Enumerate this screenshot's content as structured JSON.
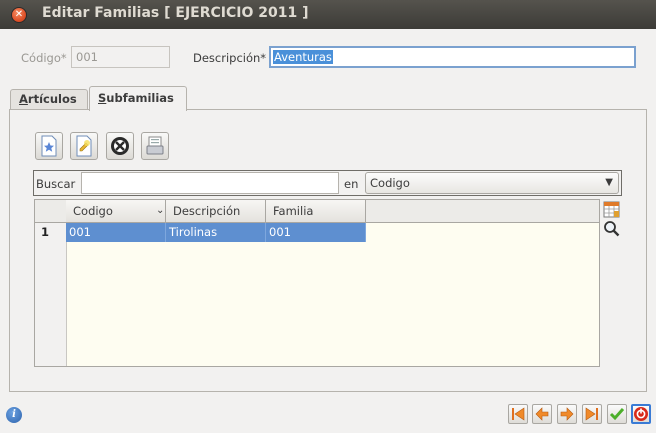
{
  "window": {
    "title": "Editar Familias [ EJERCICIO 2011 ]"
  },
  "form": {
    "codigo_label": "Código*",
    "codigo_value": "001",
    "descripcion_label": "Descripción*",
    "descripcion_value": "Aventuras"
  },
  "tabs": [
    {
      "label_mnemonic": "A",
      "label_rest": "rtículos",
      "active": false
    },
    {
      "label_mnemonic": "S",
      "label_rest": "ubfamilias",
      "active": true
    }
  ],
  "toolbar": {
    "icons": [
      "new-record-icon",
      "edit-record-icon",
      "delete-record-icon",
      "print-icon"
    ]
  },
  "search": {
    "label": "Buscar",
    "value": "",
    "in_label": "en",
    "field_selected": "Codigo"
  },
  "grid": {
    "columns": [
      "Codigo",
      "Descripción",
      "Familia"
    ],
    "sort_column": "Codigo",
    "rows": [
      {
        "num": "1",
        "codigo": "001",
        "descripcion": "Tirolinas",
        "familia": "001",
        "selected": true
      }
    ]
  },
  "side_icons": [
    "table-config-icon",
    "zoom-icon"
  ],
  "bottom_nav": [
    "first-icon",
    "previous-icon",
    "next-icon",
    "last-icon",
    "accept-icon",
    "cancel-icon"
  ],
  "colors": {
    "selection": "#5e8fd0",
    "grid_bg": "#fefdf1",
    "titlebar": "#3c3b37"
  }
}
